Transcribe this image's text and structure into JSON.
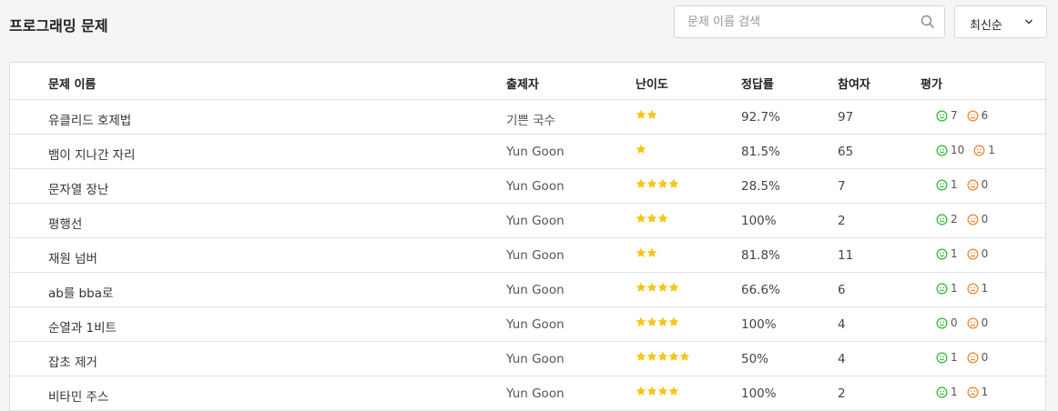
{
  "page": {
    "title": "프로그래밍 문제"
  },
  "search": {
    "placeholder": "문제 이름 검색",
    "value": ""
  },
  "sort": {
    "selected": "최신순"
  },
  "colors": {
    "star": "#f5c518",
    "good": "#2eb82e",
    "bad": "#e8862a"
  },
  "table": {
    "headers": [
      "문제 이름",
      "출제자",
      "난이도",
      "정답률",
      "참여자",
      "평가"
    ],
    "rows": [
      {
        "title": "유클리드 호제법",
        "author": "기쁜 국수",
        "stars": 2,
        "rate": "92.7%",
        "participants": "97",
        "good": "7",
        "bad": "6"
      },
      {
        "title": "뱀이 지나간 자리",
        "author": "Yun Goon",
        "stars": 1,
        "rate": "81.5%",
        "participants": "65",
        "good": "10",
        "bad": "1"
      },
      {
        "title": "문자열 장난",
        "author": "Yun Goon",
        "stars": 4,
        "rate": "28.5%",
        "participants": "7",
        "good": "1",
        "bad": "0"
      },
      {
        "title": "평행선",
        "author": "Yun Goon",
        "stars": 3,
        "rate": "100%",
        "participants": "2",
        "good": "2",
        "bad": "0"
      },
      {
        "title": "재원 넘버",
        "author": "Yun Goon",
        "stars": 2,
        "rate": "81.8%",
        "participants": "11",
        "good": "1",
        "bad": "0"
      },
      {
        "title": "ab를 bba로",
        "author": "Yun Goon",
        "stars": 4,
        "rate": "66.6%",
        "participants": "6",
        "good": "1",
        "bad": "1"
      },
      {
        "title": "순열과 1비트",
        "author": "Yun Goon",
        "stars": 4,
        "rate": "100%",
        "participants": "4",
        "good": "0",
        "bad": "0"
      },
      {
        "title": "잡초 제거",
        "author": "Yun Goon",
        "stars": 5,
        "rate": "50%",
        "participants": "4",
        "good": "1",
        "bad": "0"
      },
      {
        "title": "비타민 주스",
        "author": "Yun Goon",
        "stars": 4,
        "rate": "100%",
        "participants": "2",
        "good": "1",
        "bad": "1"
      }
    ]
  }
}
